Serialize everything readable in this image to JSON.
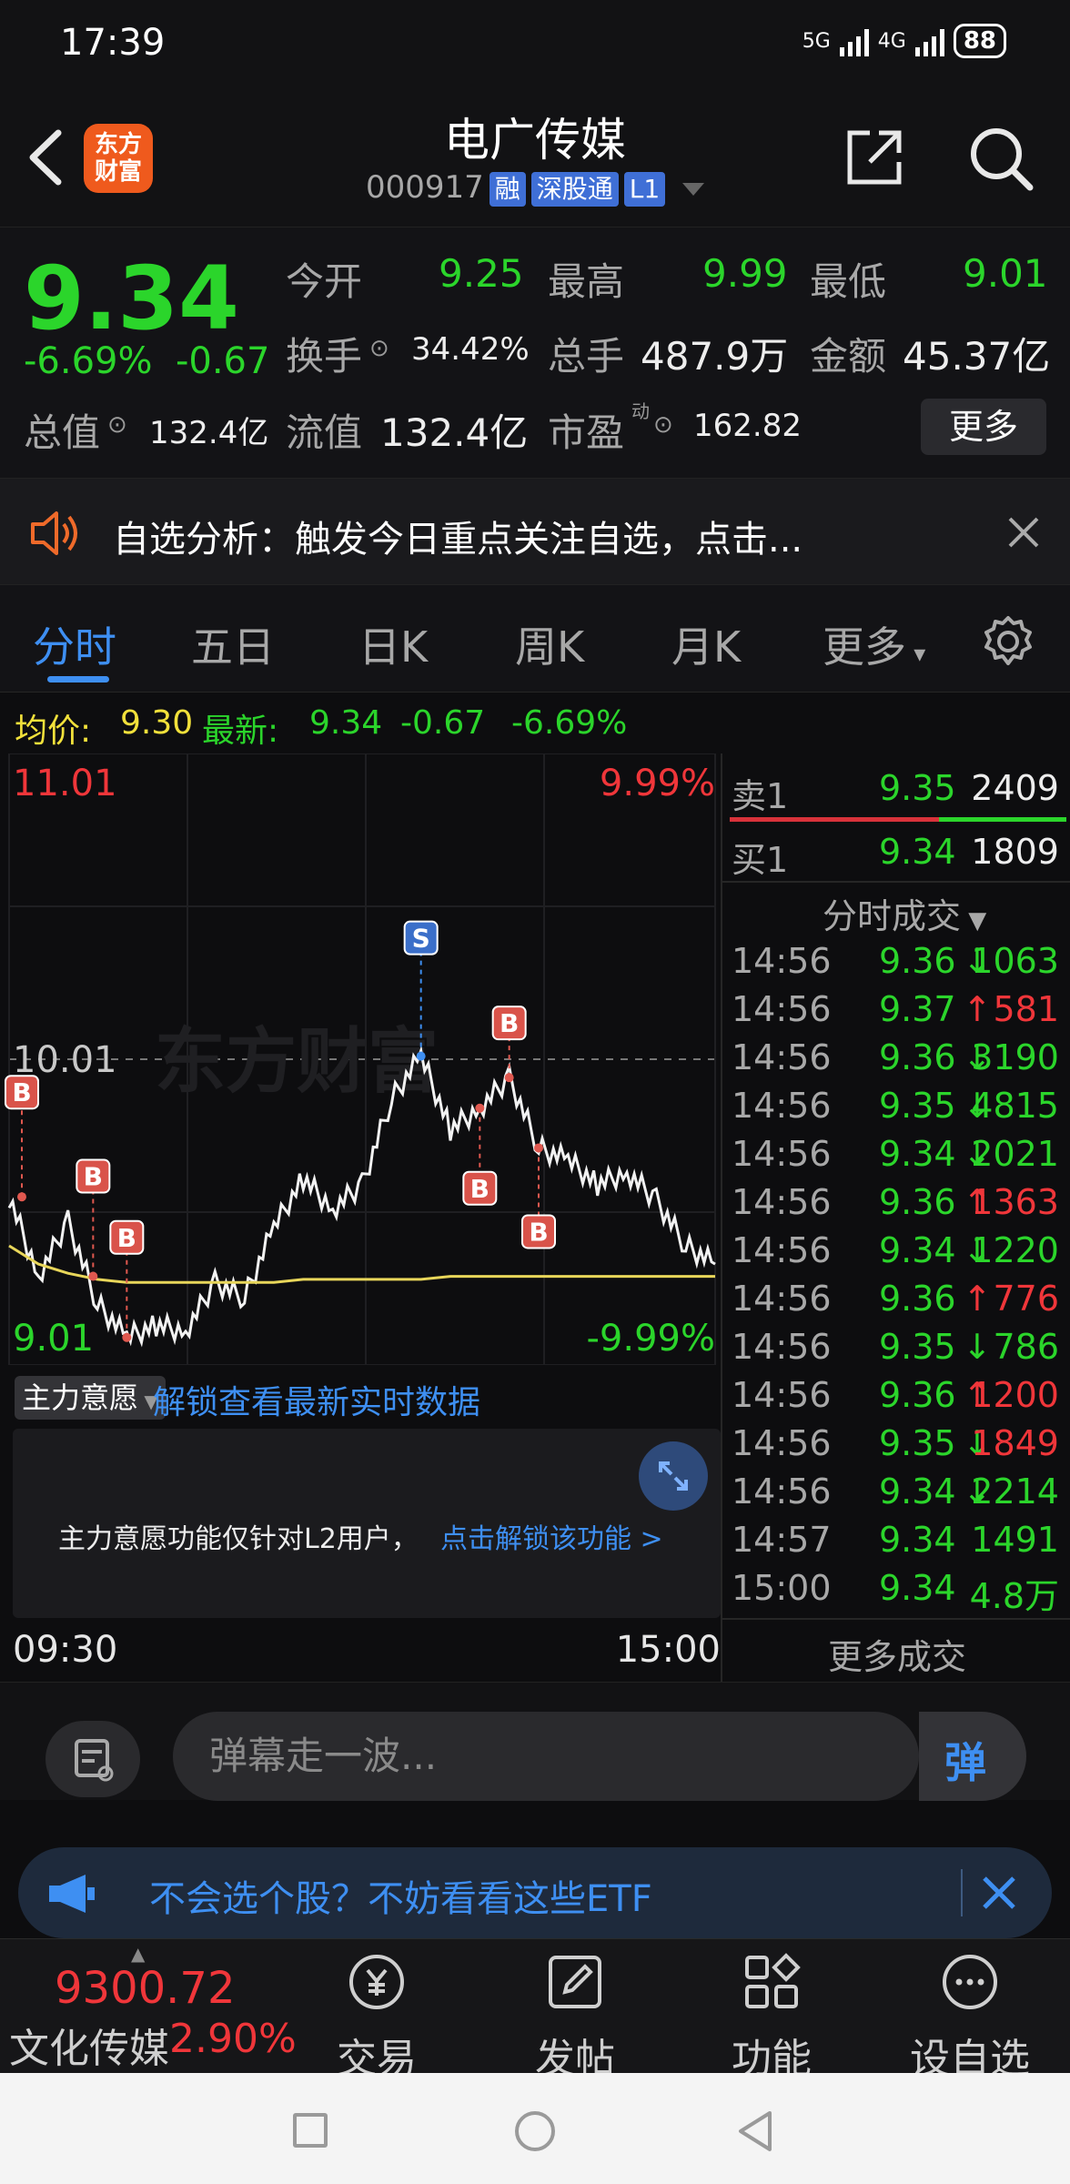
{
  "status": {
    "time": "17:39",
    "net1": "5G",
    "net2": "4G",
    "battery": "88"
  },
  "header": {
    "logo": "东方\n财富",
    "stock_name": "电广传媒",
    "stock_code": "000917",
    "tags": [
      "融",
      "深股通",
      "L1"
    ]
  },
  "quote": {
    "price": "9.34",
    "change_pct": "-6.69%",
    "change": "-0.67",
    "open_label": "今开",
    "open": "9.25",
    "high_label": "最高",
    "high": "9.99",
    "low_label": "最低",
    "low": "9.01",
    "turnover_label": "换手",
    "turnover": "34.42%",
    "volume_label": "总手",
    "volume": "487.9万",
    "amount_label": "金额",
    "amount": "45.37亿",
    "mktcap_label": "总值",
    "mktcap": "132.4亿",
    "float_label": "流值",
    "float": "132.4亿",
    "pe_label": "市盈",
    "pe_sup": "动",
    "pe": "162.82",
    "more": "更多"
  },
  "notice": {
    "text": "自选分析：触发今日重点关注自选，点击..."
  },
  "tabs": [
    "分时",
    "五日",
    "日K",
    "周K",
    "月K",
    "更多"
  ],
  "avg_bar": {
    "avg_label": "均价:",
    "avg": "9.30",
    "latest_label": "最新:",
    "latest": "9.34",
    "change": "-0.67",
    "pct": "-6.69%"
  },
  "chart": {
    "top_price": "11.01",
    "top_pct": "9.99%",
    "mid_price": "10.01",
    "bottom_price": "9.01",
    "bottom_pct": "-9.99%",
    "start_time": "09:30",
    "end_time": "15:00",
    "watermark": "东方财富",
    "markers": [
      "B",
      "B",
      "B",
      "S",
      "B",
      "B",
      "B"
    ]
  },
  "chart_data": {
    "type": "line",
    "title": "",
    "x": [
      "09:30",
      "15:00"
    ],
    "series": [
      {
        "name": "",
        "values": [
          9.56,
          9.3,
          9.48,
          9.21,
          9.1,
          9.14,
          9.12,
          9.28,
          9.23,
          9.46,
          9.62,
          9.52,
          9.6,
          9.88,
          10.02,
          9.78,
          9.85,
          9.95,
          9.72,
          9.68,
          9.6,
          9.64,
          9.55,
          9.4,
          9.34
        ]
      },
      {
        "name": "",
        "values": [
          9.4,
          9.34,
          9.31,
          9.29,
          9.28,
          9.28,
          9.28,
          9.28,
          9.28,
          9.28,
          9.29,
          9.29,
          9.29,
          9.29,
          9.29,
          9.3,
          9.3,
          9.3,
          9.3,
          9.3,
          9.3,
          9.3,
          9.3,
          9.3,
          9.3
        ]
      }
    ],
    "ylim": [
      9.01,
      11.01
    ]
  },
  "order_book": {
    "sell_label": "卖1",
    "sell_price": "9.35",
    "sell_vol": "2409",
    "buy_label": "买1",
    "buy_price": "9.34",
    "buy_vol": "1809",
    "trades_header": "分时成交",
    "trades": [
      {
        "t": "14:56",
        "p": "9.36",
        "dir": "↓",
        "v": "1063",
        "c": "green"
      },
      {
        "t": "14:56",
        "p": "9.37",
        "dir": "↑",
        "v": "581",
        "c": "red"
      },
      {
        "t": "14:56",
        "p": "9.36",
        "dir": "↓",
        "v": "3190",
        "c": "green"
      },
      {
        "t": "14:56",
        "p": "9.35",
        "dir": "↓",
        "v": "4815",
        "c": "green"
      },
      {
        "t": "14:56",
        "p": "9.34",
        "dir": "↓",
        "v": "2021",
        "c": "green"
      },
      {
        "t": "14:56",
        "p": "9.36",
        "dir": "↑",
        "v": "1363",
        "c": "red"
      },
      {
        "t": "14:56",
        "p": "9.34",
        "dir": "↓",
        "v": "1220",
        "c": "green"
      },
      {
        "t": "14:56",
        "p": "9.36",
        "dir": "↑",
        "v": "776",
        "c": "red"
      },
      {
        "t": "14:56",
        "p": "9.35",
        "dir": "↓",
        "v": "786",
        "c": "green"
      },
      {
        "t": "14:56",
        "p": "9.36",
        "dir": "↑",
        "v": "1200",
        "c": "red"
      },
      {
        "t": "14:56",
        "p": "9.35",
        "dir": "↓",
        "v": "1849",
        "c": "red"
      },
      {
        "t": "14:56",
        "p": "9.34",
        "dir": "↓",
        "v": "2214",
        "c": "green"
      },
      {
        "t": "14:57",
        "p": "9.34",
        "dir": "",
        "v": "1491",
        "c": "green"
      },
      {
        "t": "15:00",
        "p": "9.34",
        "dir": "",
        "v": "4.8万",
        "c": "green"
      }
    ],
    "more_trades": "更多成交"
  },
  "main_force": {
    "tag": "主力意愿",
    "link": "解锁查看最新实时数据",
    "text": "主力意愿功能仅针对L2用户，",
    "unlock": "点击解锁该功能 >"
  },
  "comment": {
    "placeholder": "弹幕走一波...",
    "send": "弹"
  },
  "etf_banner": {
    "text": "不会选个股？不妨看看这些ETF"
  },
  "bottom_nav": {
    "index_value": "9300.72",
    "index_name": "文化传媒",
    "index_pct": "2.90%",
    "items": [
      "交易",
      "发帖",
      "功能",
      "设自选"
    ]
  }
}
